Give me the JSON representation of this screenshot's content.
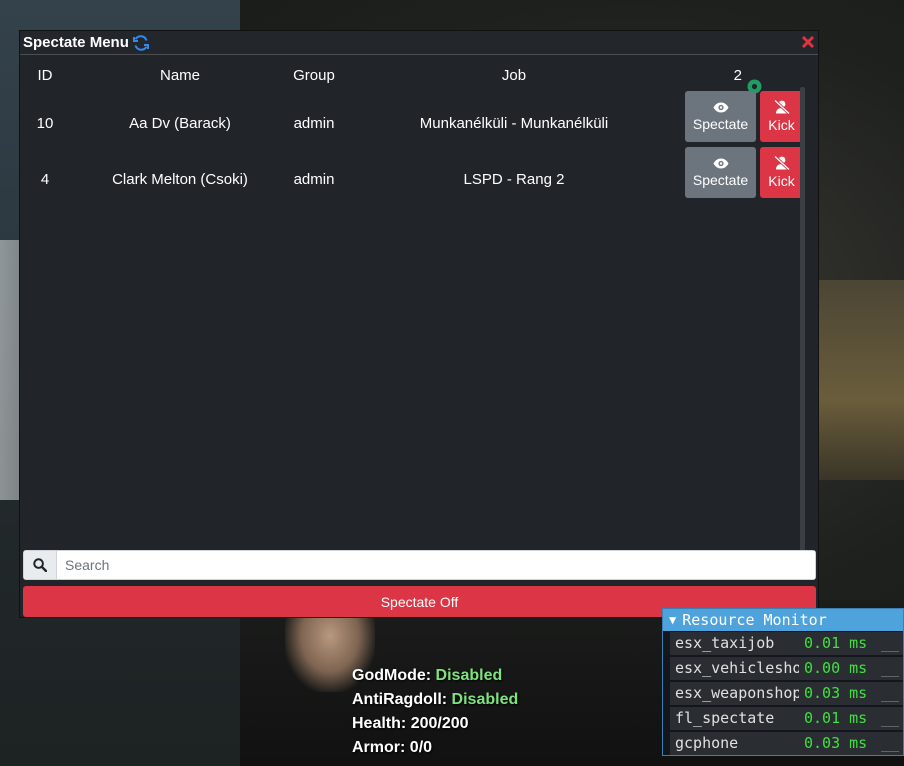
{
  "window": {
    "title": "Spectate Menu",
    "refresh_icon": "refresh-icon",
    "close_icon": "close-icon"
  },
  "table": {
    "headers": {
      "id": "ID",
      "name": "Name",
      "group": "Group",
      "job": "Job"
    },
    "online_count": "2",
    "rows": [
      {
        "id": "10",
        "name": "Aa Dv (Barack)",
        "group": "admin",
        "job": "Munkanélküli - Munkanélküli",
        "spectate_label": "Spectate",
        "kick_label": "Kick"
      },
      {
        "id": "4",
        "name": "Clark Melton (Csoki)",
        "group": "admin",
        "job": "LSPD - Rang 2",
        "spectate_label": "Spectate",
        "kick_label": "Kick"
      }
    ]
  },
  "search": {
    "placeholder": "Search",
    "value": ""
  },
  "spectate_off_label": "Spectate Off",
  "status": {
    "godmode_label": "GodMode:",
    "godmode_value": "Disabled",
    "antiragdoll_label": "AntiRagdoll:",
    "antiragdoll_value": "Disabled",
    "health_label": "Health:",
    "health_value": "200/200",
    "armor_label": "Armor:",
    "armor_value": "0/0"
  },
  "resource_monitor": {
    "title": "Resource Monitor",
    "rows": [
      {
        "name": "esx_taxijob",
        "ms": "0.01 ms",
        "graph": "__"
      },
      {
        "name": "esx_vehicleshop",
        "ms": "0.00 ms",
        "graph": "__"
      },
      {
        "name": "esx_weaponshop",
        "ms": "0.03 ms",
        "graph": "__"
      },
      {
        "name": "fl_spectate",
        "ms": "0.01 ms",
        "graph": "__"
      },
      {
        "name": "gcphone",
        "ms": "0.03 ms",
        "graph": "__"
      }
    ]
  },
  "colors": {
    "window_bg": "#212529",
    "spectate_button": "#6c757d",
    "kick_button": "#dc3545",
    "refresh_icon": "#2e8cf0",
    "online_indicator": "#1f9d63",
    "status_enabled_text": "#7ee37e",
    "resmon_header": "#4fa3dd",
    "resmon_value": "#3fe03f"
  }
}
